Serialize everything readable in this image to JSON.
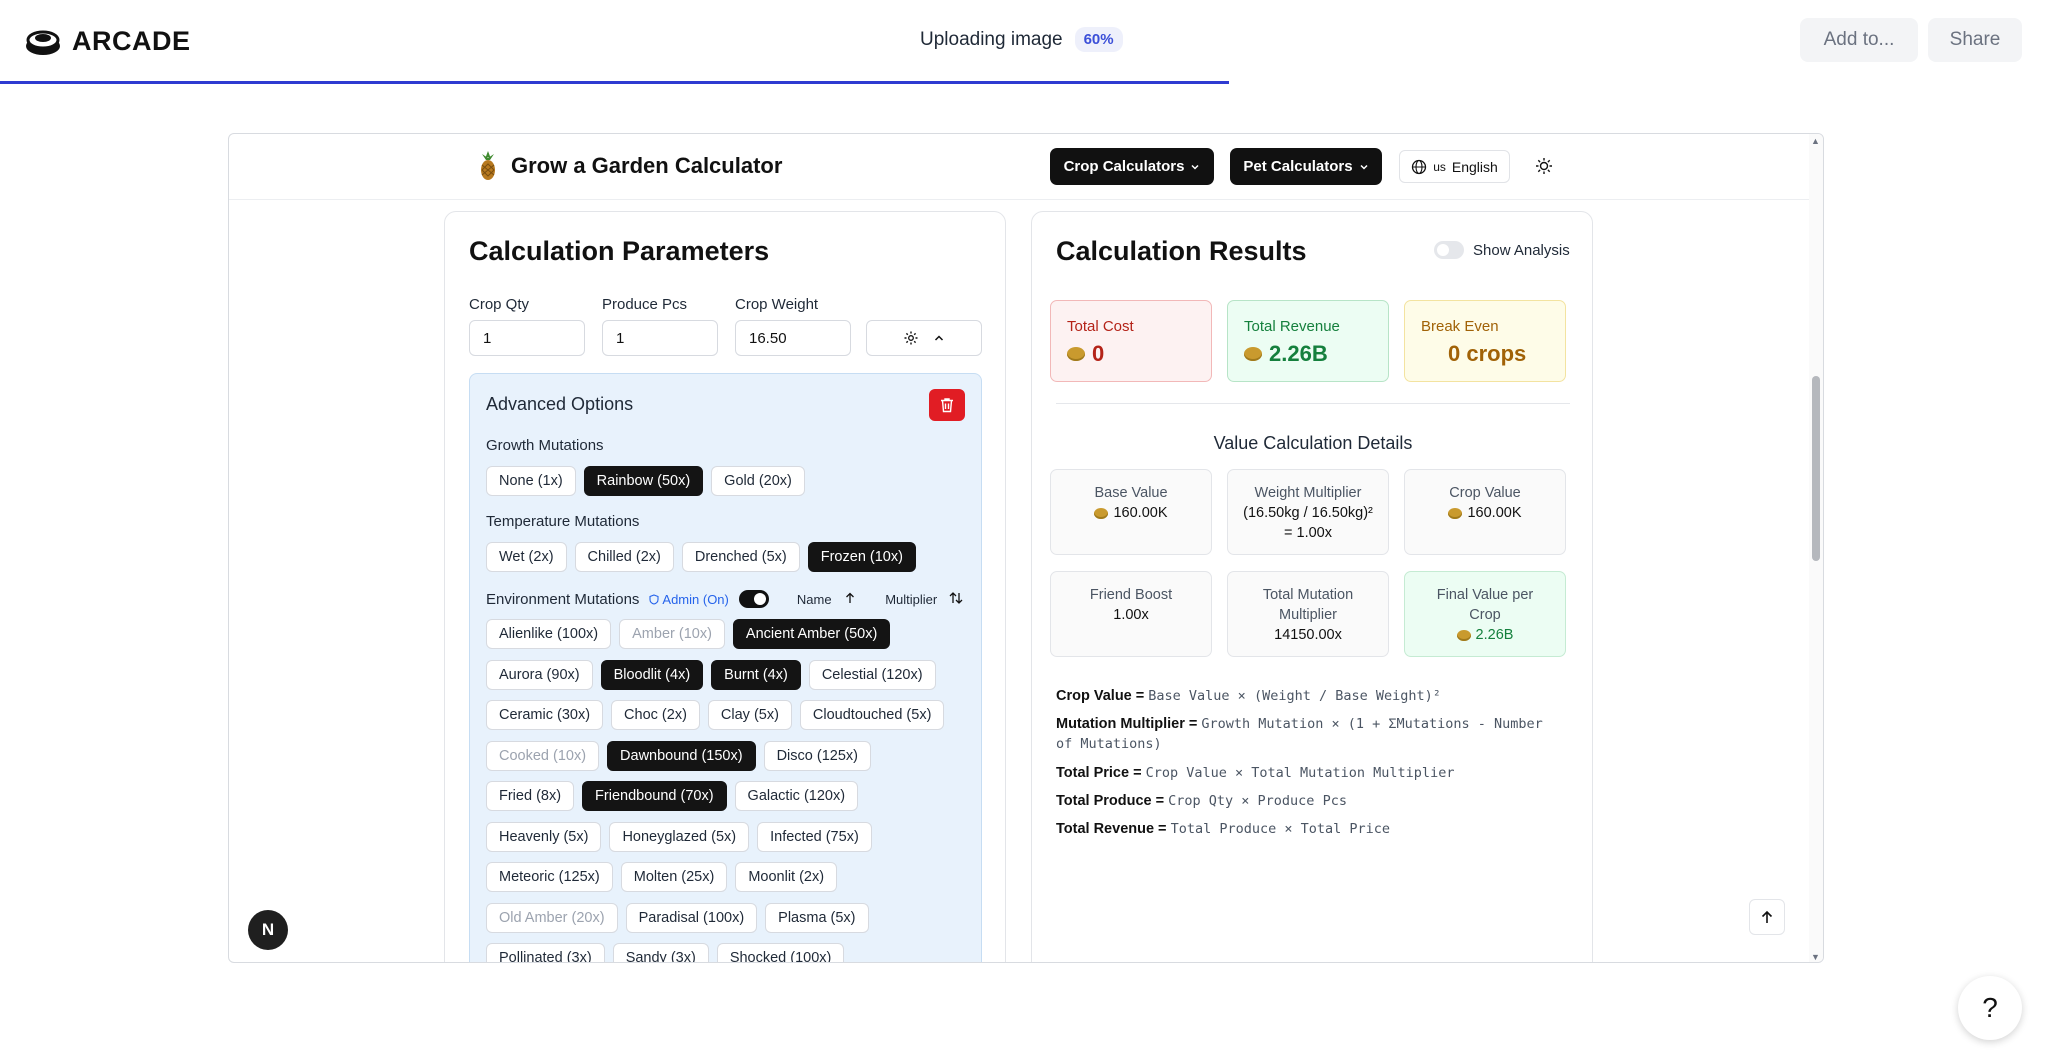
{
  "arcade": {
    "logo_text": "ARCADE",
    "upload_text": "Uploading image",
    "upload_percent": "60%",
    "upload_progress": 0.6,
    "add_to_label": "Add to...",
    "share_label": "Share",
    "help_label": "?"
  },
  "site": {
    "title": "Grow a Garden Calculator",
    "nav_crop": "Crop Calculators",
    "nav_pet": "Pet Calculators",
    "lang_flag": "us",
    "lang_label": "English"
  },
  "params": {
    "title": "Calculation Parameters",
    "crop_qty_label": "Crop Qty",
    "crop_qty_value": "1",
    "produce_pcs_label": "Produce Pcs",
    "produce_pcs_value": "1",
    "crop_weight_label": "Crop Weight",
    "crop_weight_value": "16.50",
    "advanced_title": "Advanced Options",
    "growth_label": "Growth Mutations",
    "growth": [
      {
        "label": "None (1x)",
        "selected": false
      },
      {
        "label": "Rainbow (50x)",
        "selected": true
      },
      {
        "label": "Gold (20x)",
        "selected": false
      }
    ],
    "temperature_label": "Temperature Mutations",
    "temperature": [
      {
        "label": "Wet (2x)",
        "selected": false
      },
      {
        "label": "Chilled (2x)",
        "selected": false
      },
      {
        "label": "Drenched (5x)",
        "selected": false
      },
      {
        "label": "Frozen (10x)",
        "selected": true
      }
    ],
    "environment_label": "Environment Mutations",
    "admin_label": "Admin (On)",
    "sort_name": "Name",
    "sort_multiplier": "Multiplier",
    "environment_rows": [
      [
        {
          "label": "Alienlike (100x)",
          "state": "normal"
        },
        {
          "label": "Amber (10x)",
          "state": "dim"
        },
        {
          "label": "Ancient Amber (50x)",
          "state": "on"
        }
      ],
      [
        {
          "label": "Aurora (90x)",
          "state": "normal"
        },
        {
          "label": "Bloodlit (4x)",
          "state": "on"
        },
        {
          "label": "Burnt (4x)",
          "state": "on"
        },
        {
          "label": "Celestial (120x)",
          "state": "normal"
        }
      ],
      [
        {
          "label": "Ceramic (30x)",
          "state": "normal"
        },
        {
          "label": "Choc (2x)",
          "state": "normal"
        },
        {
          "label": "Clay (5x)",
          "state": "normal"
        },
        {
          "label": "Cloudtouched (5x)",
          "state": "normal"
        }
      ],
      [
        {
          "label": "Cooked (10x)",
          "state": "dim"
        },
        {
          "label": "Dawnbound (150x)",
          "state": "on"
        },
        {
          "label": "Disco (125x)",
          "state": "normal"
        }
      ],
      [
        {
          "label": "Fried (8x)",
          "state": "normal"
        },
        {
          "label": "Friendbound (70x)",
          "state": "on"
        },
        {
          "label": "Galactic (120x)",
          "state": "normal"
        }
      ],
      [
        {
          "label": "Heavenly (5x)",
          "state": "normal"
        },
        {
          "label": "Honeyglazed (5x)",
          "state": "normal"
        },
        {
          "label": "Infected (75x)",
          "state": "normal"
        }
      ],
      [
        {
          "label": "Meteoric (125x)",
          "state": "normal"
        },
        {
          "label": "Molten (25x)",
          "state": "normal"
        },
        {
          "label": "Moonlit (2x)",
          "state": "normal"
        }
      ],
      [
        {
          "label": "Old Amber (20x)",
          "state": "dim"
        },
        {
          "label": "Paradisal (100x)",
          "state": "normal"
        },
        {
          "label": "Plasma (5x)",
          "state": "normal"
        }
      ],
      [
        {
          "label": "Pollinated (3x)",
          "state": "normal"
        },
        {
          "label": "Sandy (3x)",
          "state": "normal"
        },
        {
          "label": "Shocked (100x)",
          "state": "normal"
        }
      ]
    ]
  },
  "results": {
    "title": "Calculation Results",
    "show_analysis": "Show Analysis",
    "total_cost_label": "Total Cost",
    "total_cost_value": "0",
    "total_revenue_label": "Total Revenue",
    "total_revenue_value": "2.26B",
    "break_even_label": "Break Even",
    "break_even_value": "0 crops",
    "details_title": "Value Calculation Details",
    "base_value_label": "Base Value",
    "base_value": "160.00K",
    "weight_mult_label": "Weight Multiplier",
    "weight_mult_formula": "(16.50kg / 16.50kg)²",
    "weight_mult_value": "= 1.00x",
    "crop_value_label": "Crop Value",
    "crop_value": "160.00K",
    "friend_boost_label": "Friend Boost",
    "friend_boost_value": "1.00x",
    "total_mutation_label_1": "Total Mutation",
    "total_mutation_label_2": "Multiplier",
    "total_mutation_value": "14150.00x",
    "final_value_label_1": "Final Value per",
    "final_value_label_2": "Crop",
    "final_value": "2.26B",
    "formulas": [
      {
        "name": "Crop Value =",
        "expr": "Base Value × (Weight / Base Weight)²"
      },
      {
        "name": "Mutation Multiplier =",
        "expr": "Growth Mutation × (1 + ΣMutations - Number of Mutations)"
      },
      {
        "name": "Total Price =",
        "expr": "Crop Value × Total Mutation Multiplier"
      },
      {
        "name": "Total Produce =",
        "expr": "Crop Qty × Produce Pcs"
      },
      {
        "name": "Total Revenue =",
        "expr": "Total Produce × Total Price"
      }
    ]
  },
  "colors": {
    "progress": "#2f3bd1",
    "cost_bg": "#fdf2f2",
    "cost_border": "#f2b8b8",
    "cost_text": "#b42318",
    "revenue_bg": "#ecfdf3",
    "revenue_border": "#b7e4c7",
    "revenue_text": "#15803d",
    "even_bg": "#fefce8",
    "even_border": "#f3e3a0",
    "even_text": "#a16207"
  },
  "icons": {
    "logo": "arcade-logo-icon",
    "globe": "globe-icon",
    "theme": "sun-icon",
    "settings": "gear-icon",
    "trash": "trash-icon",
    "scroll_top": "arrow-up-icon"
  }
}
